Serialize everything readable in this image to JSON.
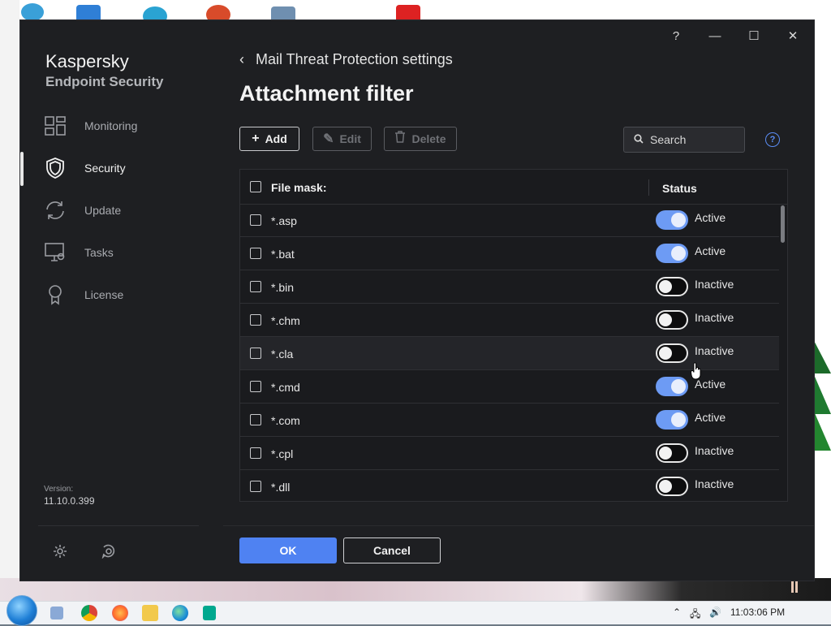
{
  "app": {
    "brand_line1": "Kaspersky",
    "brand_line2": "Endpoint Security",
    "version_label": "Version:",
    "version_value": "11.10.0.399"
  },
  "titlebar": {
    "help": "?",
    "minimize": "—",
    "maximize": "☐",
    "close": "✕"
  },
  "sidebar": {
    "items": [
      {
        "label": "Monitoring",
        "icon": "dashboard-icon",
        "active": false
      },
      {
        "label": "Security",
        "icon": "shield-icon",
        "active": true
      },
      {
        "label": "Update",
        "icon": "refresh-icon",
        "active": false
      },
      {
        "label": "Tasks",
        "icon": "monitor-gear-icon",
        "active": false
      },
      {
        "label": "License",
        "icon": "award-icon",
        "active": false
      }
    ]
  },
  "header": {
    "breadcrumb": "Mail Threat Protection settings",
    "title": "Attachment filter"
  },
  "toolbar": {
    "add_label": "Add",
    "edit_label": "Edit",
    "delete_label": "Delete",
    "search_placeholder": "Search"
  },
  "table": {
    "col_mask": "File mask:",
    "col_status": "Status",
    "rows": [
      {
        "mask": "*.asp",
        "active": true,
        "status": "Active"
      },
      {
        "mask": "*.bat",
        "active": true,
        "status": "Active"
      },
      {
        "mask": "*.bin",
        "active": false,
        "status": "Inactive"
      },
      {
        "mask": "*.chm",
        "active": false,
        "status": "Inactive"
      },
      {
        "mask": "*.cla",
        "active": false,
        "status": "Inactive"
      },
      {
        "mask": "*.cmd",
        "active": true,
        "status": "Active"
      },
      {
        "mask": "*.com",
        "active": true,
        "status": "Active"
      },
      {
        "mask": "*.cpl",
        "active": false,
        "status": "Inactive"
      },
      {
        "mask": "*.dll",
        "active": false,
        "status": "Inactive"
      }
    ]
  },
  "footer": {
    "ok_label": "OK",
    "cancel_label": "Cancel"
  },
  "taskbar": {
    "clock": "11:03:06 PM"
  },
  "colors": {
    "accent": "#4f82f2",
    "toggle_on": "#6d9bf4",
    "window_bg": "#1e1f22"
  }
}
